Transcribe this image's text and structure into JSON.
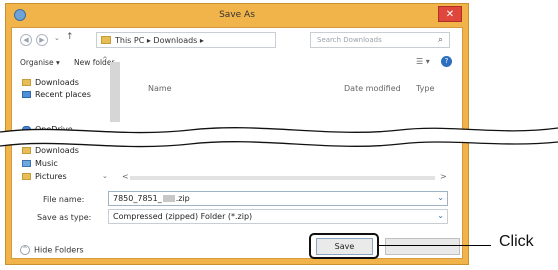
{
  "window": {
    "title": "Save As"
  },
  "address": {
    "path": "This PC  ▸  Downloads  ▸"
  },
  "search": {
    "placeholder": "Search Downloads"
  },
  "toolbar": {
    "organise": "Organise ▾",
    "new_folder": "New folder"
  },
  "nav": {
    "items": [
      {
        "label": "Downloads",
        "icon": "downloads-folder-icon"
      },
      {
        "label": "Recent places",
        "icon": "recent-places-icon"
      },
      {
        "label": "OneDrive",
        "icon": "onedrive-icon"
      },
      {
        "label": "Downloads",
        "icon": "downloads-folder-icon"
      },
      {
        "label": "Music",
        "icon": "music-icon"
      },
      {
        "label": "Pictures",
        "icon": "pictures-icon"
      }
    ]
  },
  "columns": {
    "name": "Name",
    "date": "Date modified",
    "type": "Type"
  },
  "file_name": {
    "label": "File name:",
    "value_prefix": "7850_7851_",
    "value_suffix": ".zip"
  },
  "save_type": {
    "label": "Save as type:",
    "value": "Compressed (zipped) Folder (*.zip)"
  },
  "buttons": {
    "hide_folders": "Hide Folders",
    "save": "Save"
  },
  "annotation": {
    "click": "Click"
  },
  "colors": {
    "frame": "#f0b44a",
    "close": "#e0473c",
    "help": "#2b6fbe"
  }
}
